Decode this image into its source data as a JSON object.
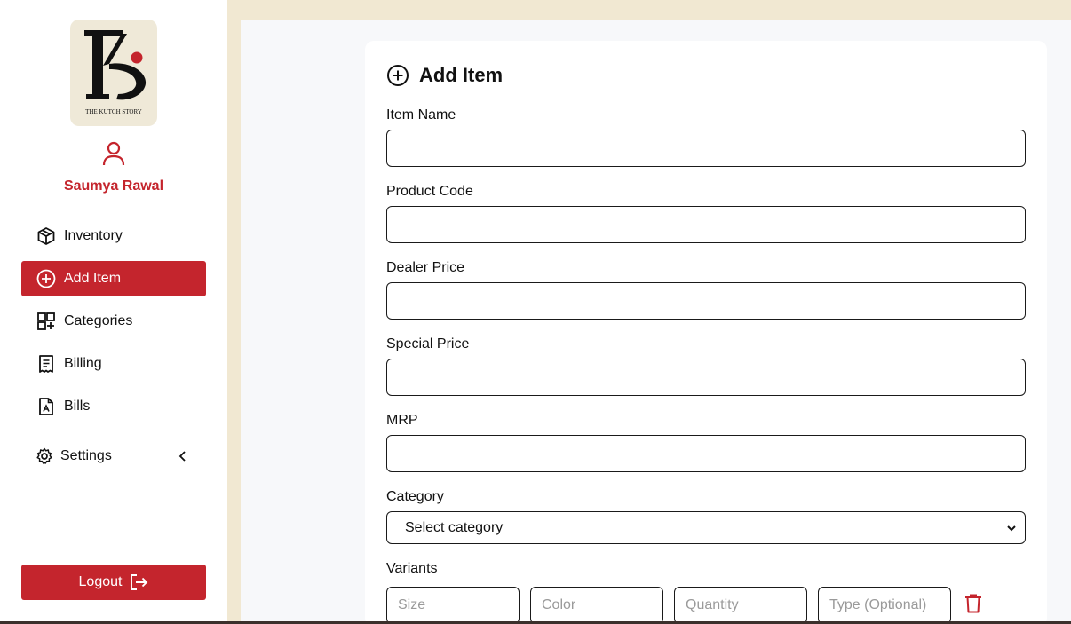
{
  "brand": {
    "name": "The Kutch Story",
    "logo_text": "THE KUTCH STORY"
  },
  "user": {
    "name": "Saumya Rawal"
  },
  "sidebar": {
    "items": [
      {
        "label": "Inventory",
        "icon": "box-icon"
      },
      {
        "label": "Add Item",
        "icon": "plus-circle-icon",
        "active": true
      },
      {
        "label": "Categories",
        "icon": "grid-plus-icon"
      },
      {
        "label": "Billing",
        "icon": "receipt-icon"
      },
      {
        "label": "Bills",
        "icon": "file-icon"
      },
      {
        "label": "Settings",
        "icon": "gear-icon",
        "expandable": true
      }
    ],
    "logout_label": "Logout"
  },
  "form": {
    "title": "Add Item",
    "fields": {
      "item_name": {
        "label": "Item Name",
        "value": ""
      },
      "product_code": {
        "label": "Product Code",
        "value": ""
      },
      "dealer_price": {
        "label": "Dealer Price",
        "value": ""
      },
      "special_price": {
        "label": "Special Price",
        "value": ""
      },
      "mrp": {
        "label": "MRP",
        "value": ""
      },
      "category": {
        "label": "Category",
        "selected": "Select category"
      }
    },
    "variants": {
      "label": "Variants",
      "size_placeholder": "Size",
      "color_placeholder": "Color",
      "quantity_placeholder": "Quantity",
      "type_placeholder": "Type (Optional)"
    }
  },
  "colors": {
    "accent": "#c4252d",
    "sidebar_bg": "#ffffff",
    "page_bg": "#f1e8d2",
    "main_bg": "#f7f8fa"
  }
}
